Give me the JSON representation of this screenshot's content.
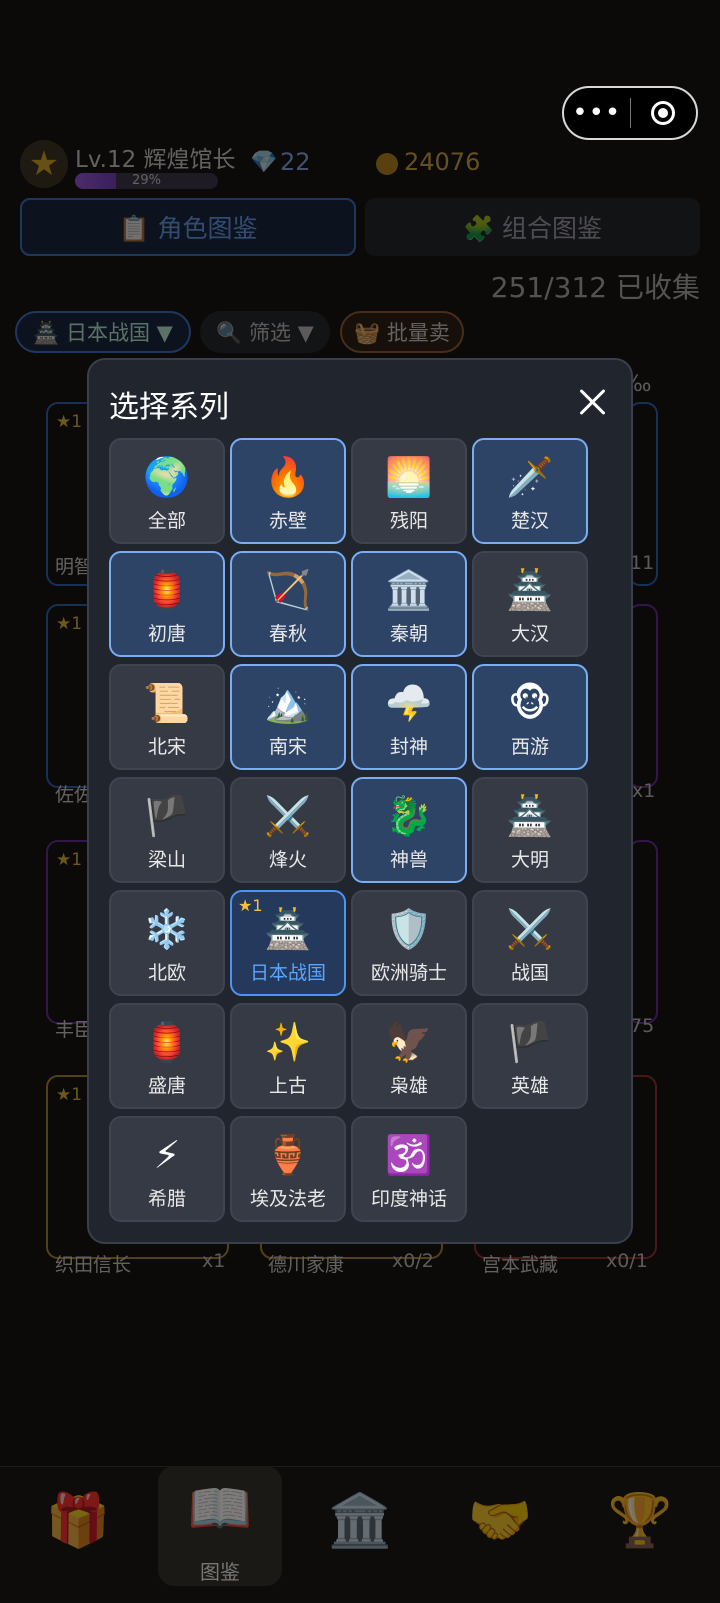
{
  "header": {
    "level_text": "Lv.12 辉煌馆长",
    "xp_percent_text": "29%",
    "xp_fraction": 0.29,
    "gems": "22",
    "coins": "24076"
  },
  "tabs": {
    "roles": "📋 角色图鉴",
    "combos": "🧩 组合图鉴"
  },
  "collected": "251/312 已收集",
  "filters": {
    "series": "🏯 日本战国 ▼",
    "filter": "🔍 筛选 ▼",
    "batch_sell": "🧺 批量卖"
  },
  "background_cards": [
    {
      "name": "明智",
      "count": "11"
    },
    {
      "name": "佐佐",
      "count": "x1"
    },
    {
      "name": "丰臣",
      "count": "75"
    },
    {
      "name": "织田信长",
      "count": "x1"
    },
    {
      "name": "德川家康",
      "count": "x0/2"
    },
    {
      "name": "宫本武藏",
      "count": "x0/1"
    }
  ],
  "background_star": "★1",
  "background_rate": "‰",
  "modal": {
    "title": "选择系列",
    "items": [
      {
        "label": "全部",
        "icon": "🌍",
        "style": "normal"
      },
      {
        "label": "赤壁",
        "icon": "🔥",
        "style": "hl"
      },
      {
        "label": "残阳",
        "icon": "🌅",
        "style": "normal"
      },
      {
        "label": "楚汉",
        "icon": "🗡️",
        "style": "hl"
      },
      {
        "label": "初唐",
        "icon": "🏮",
        "style": "hl"
      },
      {
        "label": "春秋",
        "icon": "🏹",
        "style": "hl"
      },
      {
        "label": "秦朝",
        "icon": "🏛️",
        "style": "hl"
      },
      {
        "label": "大汉",
        "icon": "🏯",
        "style": "normal"
      },
      {
        "label": "北宋",
        "icon": "📜",
        "style": "normal"
      },
      {
        "label": "南宋",
        "icon": "🏔️",
        "style": "hl"
      },
      {
        "label": "封神",
        "icon": "🌩️",
        "style": "hl"
      },
      {
        "label": "西游",
        "icon": "🐵",
        "style": "hl"
      },
      {
        "label": "梁山",
        "icon": "🏴",
        "style": "normal"
      },
      {
        "label": "烽火",
        "icon": "⚔️",
        "style": "normal"
      },
      {
        "label": "神兽",
        "icon": "🐉",
        "style": "hl"
      },
      {
        "label": "大明",
        "icon": "🏯",
        "style": "normal"
      },
      {
        "label": "北欧",
        "icon": "❄️",
        "style": "normal"
      },
      {
        "label": "日本战国",
        "icon": "🏯",
        "style": "cur",
        "star": "★1"
      },
      {
        "label": "欧洲骑士",
        "icon": "🛡️",
        "style": "normal"
      },
      {
        "label": "战国",
        "icon": "⚔️",
        "style": "normal"
      },
      {
        "label": "盛唐",
        "icon": "🏮",
        "style": "normal"
      },
      {
        "label": "上古",
        "icon": "✨",
        "style": "normal"
      },
      {
        "label": "枭雄",
        "icon": "🦅",
        "style": "normal"
      },
      {
        "label": "英雄",
        "icon": "🏴",
        "style": "normal"
      },
      {
        "label": "希腊",
        "icon": "⚡",
        "style": "normal"
      },
      {
        "label": "埃及法老",
        "icon": "🏺",
        "style": "normal"
      },
      {
        "label": "印度神话",
        "icon": "🕉️",
        "style": "normal"
      }
    ]
  },
  "nav": {
    "items": [
      {
        "icon": "🎁"
      },
      {
        "icon": "📖",
        "label": "图鉴"
      },
      {
        "icon": "🏛️"
      },
      {
        "icon": "🤝"
      },
      {
        "icon": "🏆"
      }
    ]
  },
  "colors": {
    "highlight_border": "#79aef5",
    "current_label": "#5aa6ff",
    "modal_bg": "#21252e"
  }
}
